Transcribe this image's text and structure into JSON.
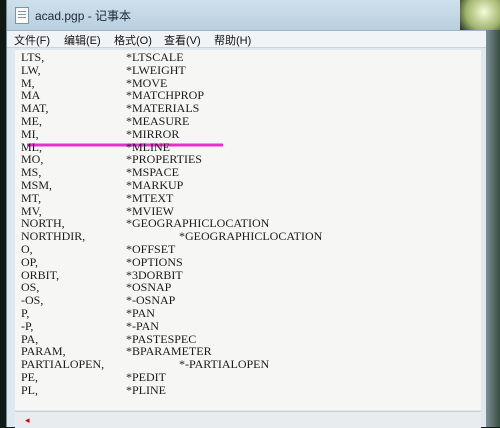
{
  "window": {
    "title": "acad.pgp - 记事本"
  },
  "menu": [
    "文件(F)",
    "编辑(E)",
    "格式(O)",
    "查看(V)",
    "帮助(H)"
  ],
  "lines": [
    {
      "alias": "LTS,",
      "command": "*LTSCALE"
    },
    {
      "alias": "LW,",
      "command": "*LWEIGHT"
    },
    {
      "alias": "M,",
      "command": "*MOVE"
    },
    {
      "alias": "MA",
      "command": "*MATCHPROP"
    },
    {
      "alias": "MAT,",
      "command": "*MATERIALS"
    },
    {
      "alias": "ME,",
      "command": "*MEASURE"
    },
    {
      "alias": "MI,",
      "command": "*MIRROR"
    },
    {
      "alias": "ML,",
      "command": "*MLINE"
    },
    {
      "alias": "MO,",
      "command": "*PROPERTIES"
    },
    {
      "alias": "MS,",
      "command": "*MSPACE"
    },
    {
      "alias": "MSM,",
      "command": "*MARKUP"
    },
    {
      "alias": "MT,",
      "command": "*MTEXT"
    },
    {
      "alias": "MV,",
      "command": "*MVIEW"
    },
    {
      "alias": "NORTH,",
      "command": "*GEOGRAPHICLOCATION"
    },
    {
      "alias": "NORTHDIR,",
      "command": "*GEOGRAPHICLOCATION"
    },
    {
      "alias": "O,",
      "command": "*OFFSET"
    },
    {
      "alias": "OP,",
      "command": "*OPTIONS"
    },
    {
      "alias": "ORBIT,",
      "command": "*3DORBIT"
    },
    {
      "alias": "OS,",
      "command": "*OSNAP"
    },
    {
      "alias": "-OS,",
      "command": "*-OSNAP"
    },
    {
      "alias": "P,",
      "command": "*PAN"
    },
    {
      "alias": "-P,",
      "command": "*-PAN"
    },
    {
      "alias": "PA,",
      "command": "*PASTESPEC"
    },
    {
      "alias": "PARAM,",
      "command": "*BPARAMETER"
    },
    {
      "alias": "PARTIALOPEN,",
      "command": "*-PARTIALOPEN"
    },
    {
      "alias": "PE,",
      "command": "*PEDIT"
    },
    {
      "alias": "PL,",
      "command": "*PLINE"
    }
  ],
  "colors": {
    "highlight": "#e62fd0"
  }
}
